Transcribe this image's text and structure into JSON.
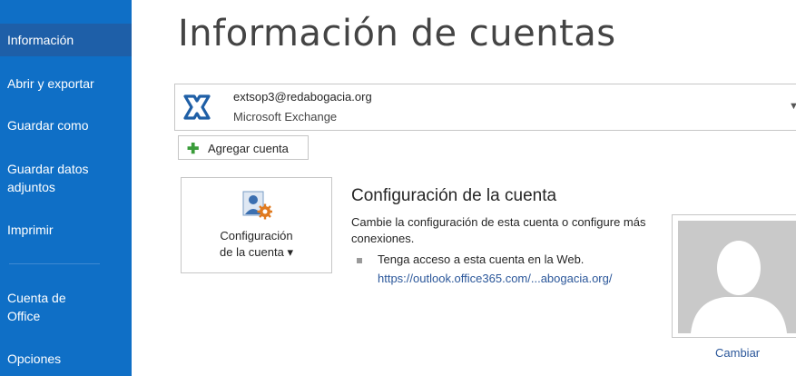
{
  "sidebar": {
    "items": [
      {
        "label": "Información"
      },
      {
        "label": "Abrir y exportar"
      },
      {
        "label": "Guardar como"
      },
      {
        "label": "Guardar datos adjuntos"
      },
      {
        "label": "Imprimir"
      },
      {
        "label": "Cuenta de Office"
      },
      {
        "label": "Opciones"
      }
    ]
  },
  "main": {
    "title": "Información de cuentas",
    "account": {
      "email": "extsop3@redabogacia.org",
      "type": "Microsoft Exchange",
      "icon": "exchange-icon"
    },
    "add_account_label": "Agregar cuenta",
    "config_button": {
      "line1": "Configuración",
      "line2": "de la cuenta ▾"
    },
    "section_title": "Configuración de la cuenta",
    "section_description": "Cambie la configuración de esta cuenta o configure más conexiones.",
    "web_access_text": "Tenga acceso a esta cuenta en la Web.",
    "web_link": "https://outlook.office365.com/...abogacia.org/",
    "change_label": "Cambiar"
  },
  "colors": {
    "sidebar_bg": "#0f6fc6",
    "sidebar_active": "#1e5fa8",
    "link": "#2b579a"
  }
}
